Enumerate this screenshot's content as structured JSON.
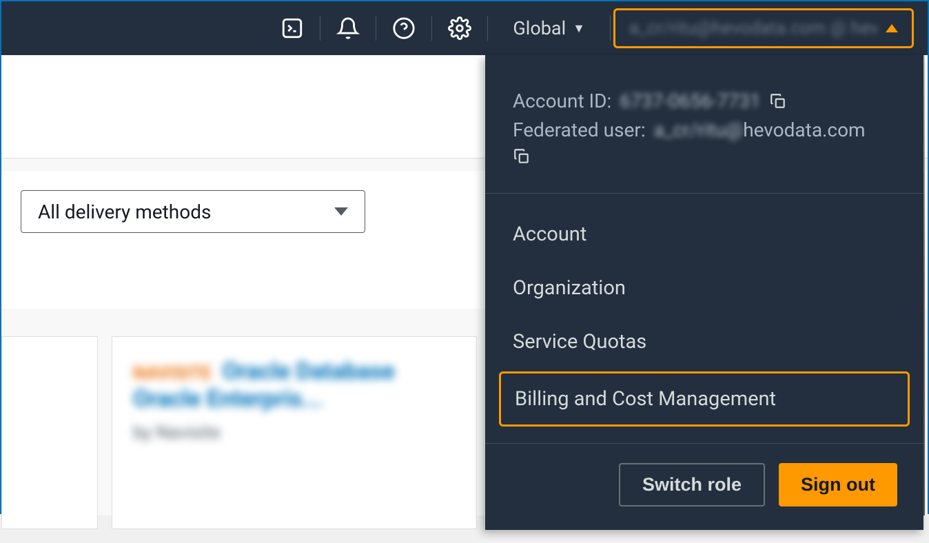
{
  "nav": {
    "region": "Global",
    "account_display": "a_cr/ritu@hevodata.com @ hevo-cr"
  },
  "account_panel": {
    "account_id_label": "Account ID:",
    "account_id_value": "6737-0656-7731",
    "federated_user_label": "Federated user:",
    "federated_user_value_blur": "a_cr/ritu@",
    "federated_user_value_clear": "hevodata.com",
    "menu": {
      "account": "Account",
      "organization": "Organization",
      "service_quotas": "Service Quotas",
      "billing": "Billing and Cost Management"
    },
    "switch_role": "Switch role",
    "sign_out": "Sign out"
  },
  "main": {
    "delivery_select": "All delivery methods",
    "card": {
      "badge": "NAVISITE",
      "title_line1": "Oracle Database",
      "title_line2": "Oracle Enterpris...",
      "by": "by Navisite"
    }
  }
}
